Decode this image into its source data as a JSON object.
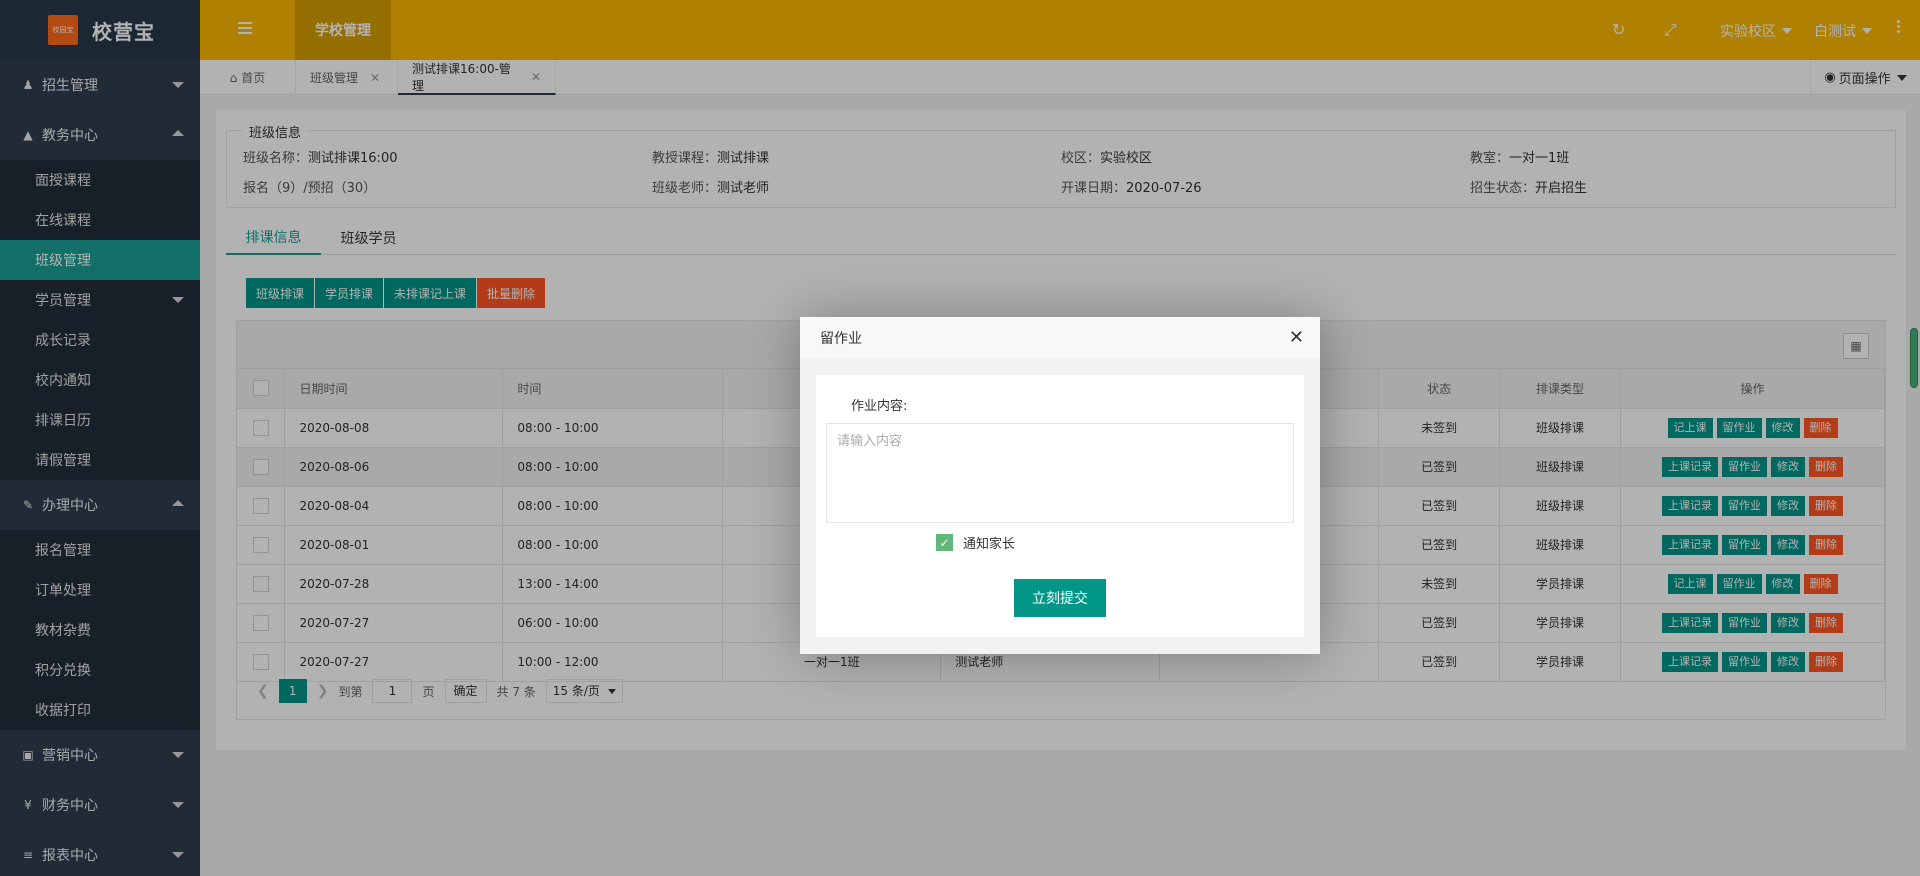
{
  "app": {
    "logo_badge": "校园宝",
    "title": "校营宝"
  },
  "sidebar": {
    "groups": [
      {
        "label": "招生管理",
        "icon": "person-icon",
        "open": false,
        "items": []
      },
      {
        "label": "教务中心",
        "icon": "graduation-cap-icon",
        "open": true,
        "items": [
          "面授课程",
          "在线课程",
          "班级管理",
          "学员管理",
          "成长记录",
          "校内通知",
          "排课日历",
          "请假管理"
        ]
      },
      {
        "label": "办理中心",
        "icon": "edit-icon",
        "open": true,
        "items": [
          "报名管理",
          "订单处理",
          "教材杂费",
          "积分兑换",
          "收据打印"
        ]
      },
      {
        "label": "营销中心",
        "icon": "laptop-icon",
        "open": false,
        "items": []
      },
      {
        "label": "财务中心",
        "icon": "yen-icon",
        "open": false,
        "items": []
      },
      {
        "label": "报表中心",
        "icon": "chart-icon",
        "open": false,
        "items": []
      }
    ],
    "active_item": "班级管理"
  },
  "header": {
    "active_tab": "学校管理",
    "campus": "实验校区",
    "user": "白测试"
  },
  "tabs": [
    {
      "label": "首页",
      "closable": false
    },
    {
      "label": "班级管理",
      "closable": true
    },
    {
      "label": "测试排课16:00-管理",
      "closable": true
    }
  ],
  "page_ops": "页面操作",
  "class_info": {
    "legend": "班级信息",
    "fields": [
      {
        "label": "班级名称：",
        "value": "测试排课16:00"
      },
      {
        "label": "教授课程：",
        "value": "测试排课"
      },
      {
        "label": "校区：",
        "value": "实验校区"
      },
      {
        "label": "教室：",
        "value": "一对一1班"
      },
      {
        "label": "报名（9）/预招（30）",
        "value": ""
      },
      {
        "label": "班级老师：",
        "value": "测试老师"
      },
      {
        "label": "开课日期：",
        "value": "2020-07-26"
      },
      {
        "label": "招生状态：",
        "value": "开启招生"
      }
    ]
  },
  "subtabs": [
    "排课信息",
    "班级学员"
  ],
  "actions": [
    "班级排课",
    "学员排课",
    "未排课记上课",
    "批量删除"
  ],
  "table": {
    "columns": [
      "日期时间",
      "时间",
      "状态",
      "排课类型",
      "操作"
    ],
    "rows": [
      {
        "date": "2020-08-08",
        "time": "08:00 - 10:00",
        "room": "",
        "teacher": "",
        "status": "未签到",
        "type": "班级排课",
        "ops": [
          "记上课",
          "留作业",
          "修改",
          "删除"
        ]
      },
      {
        "date": "2020-08-06",
        "time": "08:00 - 10:00",
        "room": "",
        "teacher": "",
        "status": "已签到",
        "type": "班级排课",
        "ops": [
          "上课记录",
          "留作业",
          "修改",
          "删除"
        ]
      },
      {
        "date": "2020-08-04",
        "time": "08:00 - 10:00",
        "room": "",
        "teacher": "",
        "status": "已签到",
        "type": "班级排课",
        "ops": [
          "上课记录",
          "留作业",
          "修改",
          "删除"
        ]
      },
      {
        "date": "2020-08-01",
        "time": "08:00 - 10:00",
        "room": "",
        "teacher": "",
        "status": "已签到",
        "type": "班级排课",
        "ops": [
          "上课记录",
          "留作业",
          "修改",
          "删除"
        ]
      },
      {
        "date": "2020-07-28",
        "time": "13:00 - 14:00",
        "room": "",
        "teacher": "",
        "status": "未签到",
        "type": "学员排课",
        "ops": [
          "记上课",
          "留作业",
          "修改",
          "删除"
        ]
      },
      {
        "date": "2020-07-27",
        "time": "06:00 - 10:00",
        "room": "",
        "teacher": "",
        "status": "已签到",
        "type": "学员排课",
        "ops": [
          "上课记录",
          "留作业",
          "修改",
          "删除"
        ]
      },
      {
        "date": "2020-07-27",
        "time": "10:00 - 12:00",
        "room": "一对一1班",
        "teacher": "测试老师",
        "status": "已签到",
        "type": "学员排课",
        "ops": [
          "上课记录",
          "留作业",
          "修改",
          "删除"
        ]
      }
    ]
  },
  "pager": {
    "current": "1",
    "goto_label": "到第",
    "goto_value": "1",
    "page_label": "页",
    "confirm": "确定",
    "total": "共 7 条",
    "per_page": "15 条/页"
  },
  "modal": {
    "title": "留作业",
    "label": "作业内容:",
    "placeholder": "请输入内容",
    "notify_label": "通知家长",
    "notify_checked": true,
    "submit": "立刻提交"
  },
  "colors": {
    "header": "#fdb902",
    "sidebar": "#2f3e4f",
    "accent": "#009688",
    "danger": "#ff5722",
    "check": "#5fb878"
  }
}
